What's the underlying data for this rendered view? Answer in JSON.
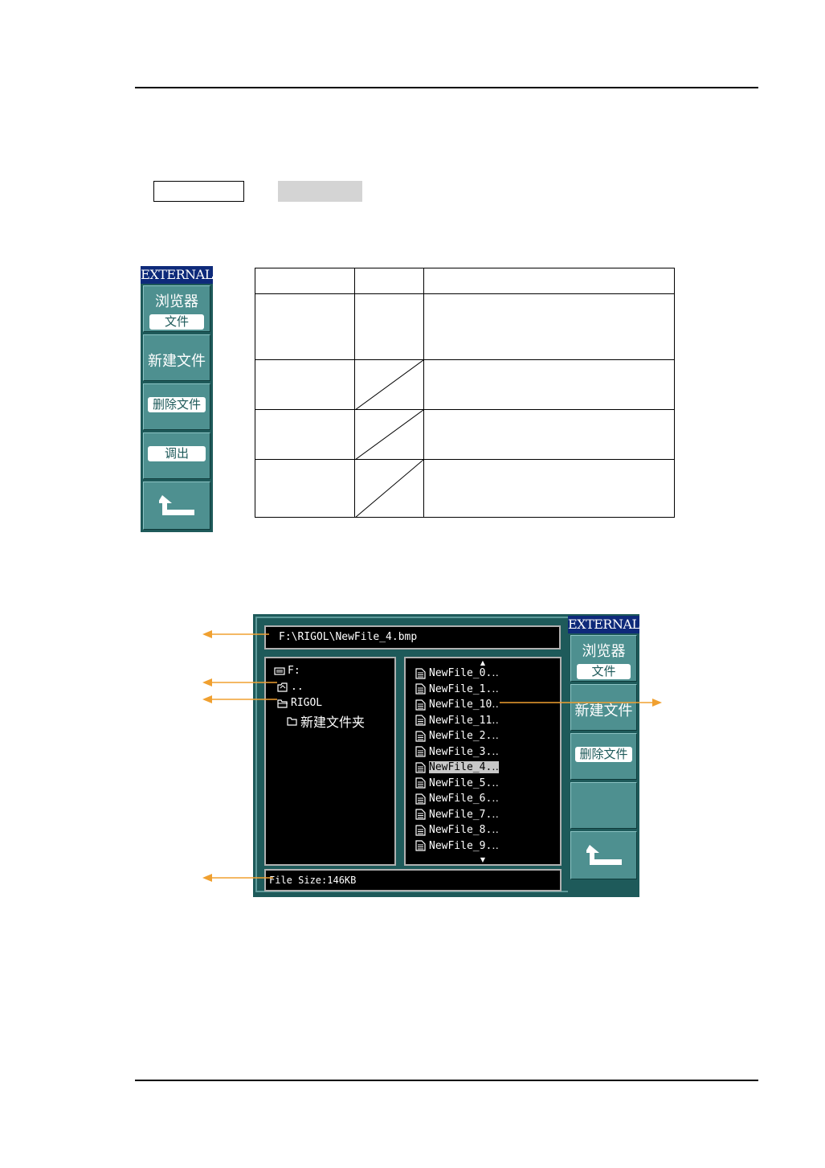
{
  "key_boxes": [
    {
      "style": "outlined",
      "text": ""
    },
    {
      "style": "shaded",
      "text": ""
    }
  ],
  "menu_panel": {
    "title": "EXTERNAL",
    "items": [
      {
        "label": "浏览器",
        "value": "文件"
      },
      {
        "label": "新建文件"
      },
      {
        "label": "删除文件"
      },
      {
        "label": "调出"
      },
      {
        "icon": "back-arrow-icon"
      }
    ]
  },
  "screen": {
    "path": "F:\\RIGOL\\NewFile_4.bmp",
    "tree": [
      {
        "icon": "drive-icon",
        "label": "F:"
      },
      {
        "icon": "parent-folder-icon",
        "label": ".."
      },
      {
        "icon": "open-folder-icon",
        "label": "RIGOL"
      },
      {
        "icon": "folder-icon",
        "label": "新建文件夹"
      }
    ],
    "files": [
      "NewFile_0.‥",
      "NewFile_1.‥",
      "NewFile_10‥",
      "NewFile_11‥",
      "NewFile_2.‥",
      "NewFile_3.‥",
      "NewFile_4.‥",
      "NewFile_5.‥",
      "NewFile_6.‥",
      "NewFile_7.‥",
      "NewFile_8.‥",
      "NewFile_9.‥"
    ],
    "selected_file": "NewFile_4.‥",
    "status": "File Size:146KB",
    "menu": {
      "title": "EXTERNAL",
      "items": [
        {
          "label": "浏览器",
          "value": "文件"
        },
        {
          "label": "新建文件"
        },
        {
          "label": "删除文件"
        },
        {
          "label": ""
        },
        {
          "icon": "back-arrow-icon"
        }
      ]
    }
  },
  "colors": {
    "panel_bg": "#1e5a5a",
    "button_bg": "#4e9090",
    "title_bg": "#0e2a7a",
    "annotation_arrow": "#f0a030"
  }
}
